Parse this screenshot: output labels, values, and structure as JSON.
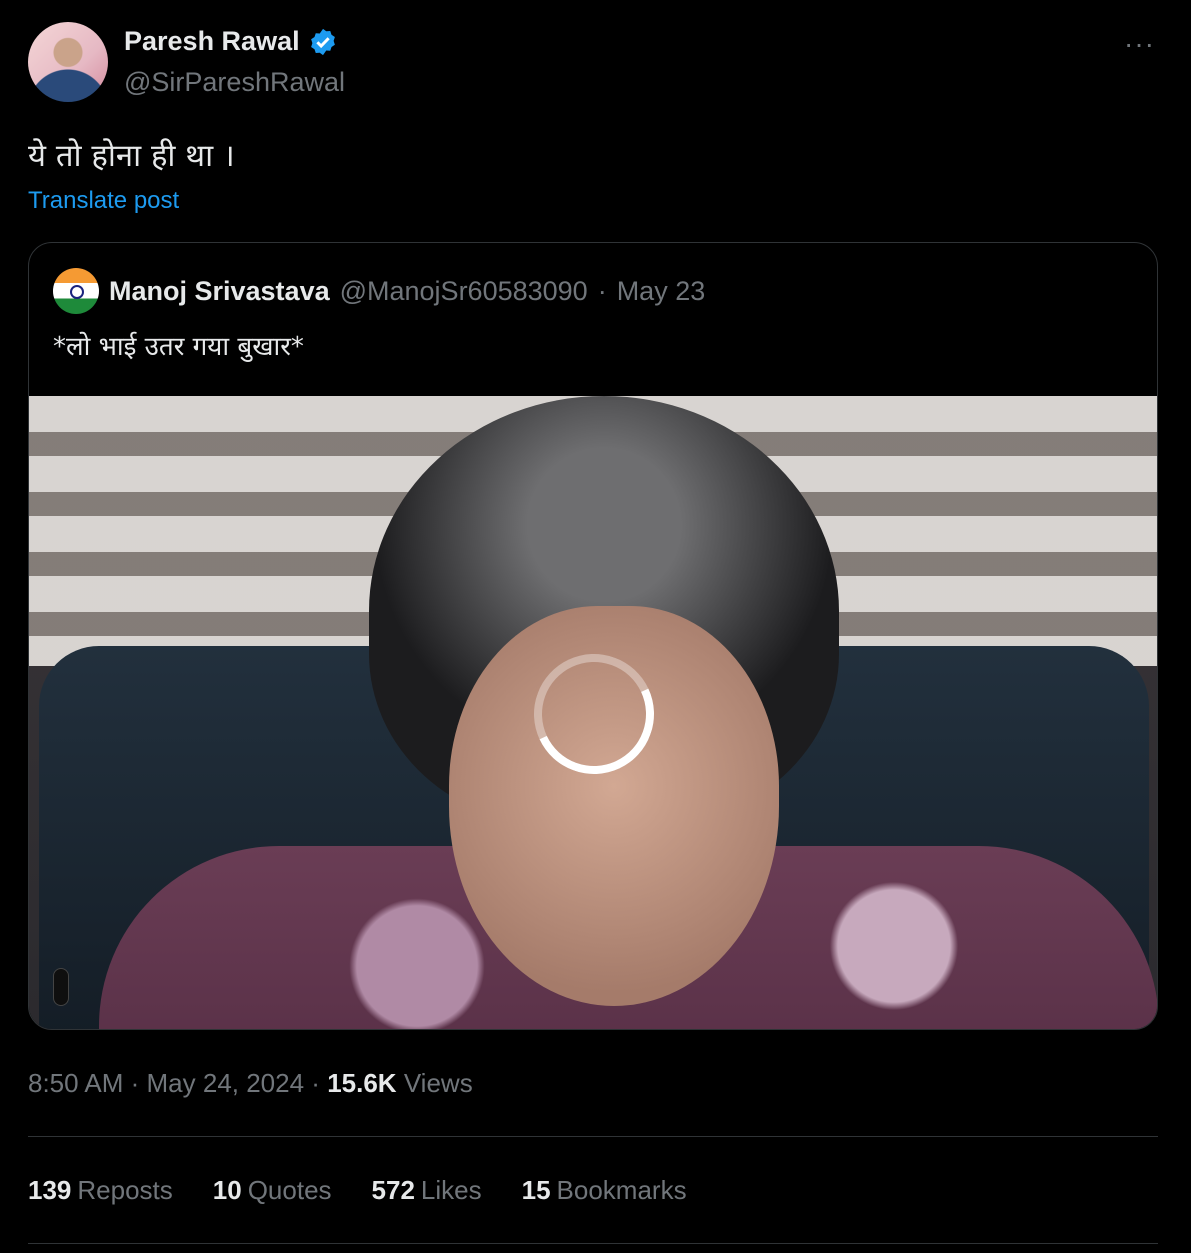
{
  "author": {
    "name": "Paresh Rawal",
    "handle": "@SirPareshRawal",
    "verified_icon": "verified-badge-icon",
    "accent_color": "#1d9bf0"
  },
  "more_label": "···",
  "tweet": {
    "text": "ये तो होना ही था ।",
    "translate_label": "Translate post"
  },
  "quote": {
    "name": "Manoj Srivastava",
    "handle": "@ManojSr60583090",
    "separator": " · ",
    "date": "May 23",
    "text": "*लो भाई उतर गया बुखार*"
  },
  "meta": {
    "time": "8:50 AM",
    "sep1": " · ",
    "date": "May 24, 2024",
    "sep2": " · ",
    "views_count": "15.6K",
    "views_label": "Views"
  },
  "stats": [
    {
      "count": "139",
      "label": "Reposts"
    },
    {
      "count": "10",
      "label": "Quotes"
    },
    {
      "count": "572",
      "label": "Likes"
    },
    {
      "count": "15",
      "label": "Bookmarks"
    }
  ]
}
